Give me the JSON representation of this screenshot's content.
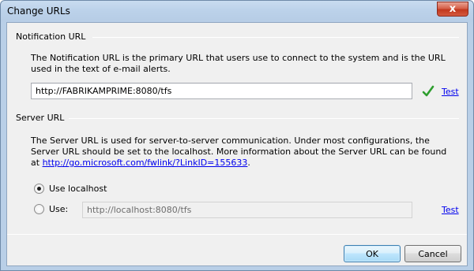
{
  "window": {
    "title": "Change URLs",
    "close_symbol": "x"
  },
  "notification": {
    "header": "Notification URL",
    "description": "The Notification URL is the primary URL that users use to connect to the system and is the URL used in the text of e-mail alerts.",
    "url_value": "http://FABRIKAMPRIME:8080/tfs",
    "test_link": "Test",
    "status_icon": "green-checkmark-icon"
  },
  "server": {
    "header": "Server URL",
    "description": "The Server URL is used for server-to-server communication. Under most configurations, the Server URL should be set to the localhost. More information about the Server URL can be found at ",
    "more_info_link": "http://go.microsoft.com/fwlink/?LinkID=155633",
    "description_end": ".",
    "option_localhost": "Use localhost",
    "option_use": "Use:",
    "use_value": "http://localhost:8080/tfs",
    "test_link": "Test",
    "selected_option": "Use localhost"
  },
  "buttons": {
    "ok": "OK",
    "cancel": "Cancel"
  },
  "colors": {
    "link": "#0000ee",
    "check": "#2e9e2e",
    "close_button": "#c2381e"
  }
}
